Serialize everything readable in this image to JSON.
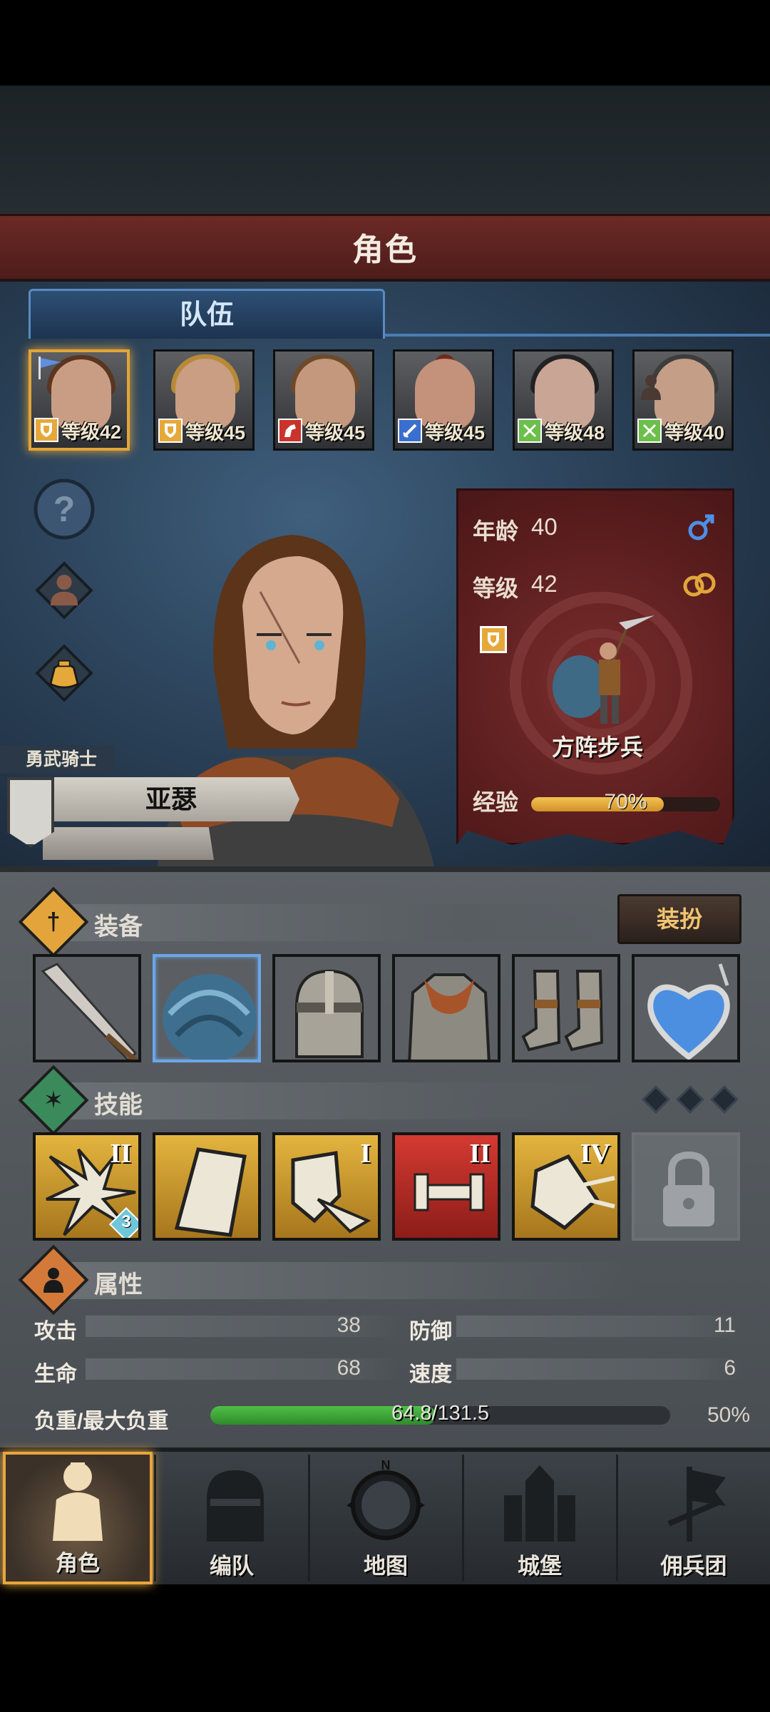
{
  "header": {
    "title": "角色"
  },
  "tabs": {
    "team": "队伍"
  },
  "heroes": [
    {
      "level": "等级42",
      "badge": "shield",
      "badge_color": "#e7a83a",
      "selected": true
    },
    {
      "level": "等级45",
      "badge": "shield",
      "badge_color": "#e7a83a"
    },
    {
      "level": "等级45",
      "badge": "horse",
      "badge_color": "#c8342c"
    },
    {
      "level": "等级45",
      "badge": "sword",
      "badge_color": "#3a6fd0"
    },
    {
      "level": "等级48",
      "badge": "bow",
      "badge_color": "#6bbf4a"
    },
    {
      "level": "等级40",
      "badge": "bow",
      "badge_color": "#6bbf4a"
    }
  ],
  "character": {
    "title": "勇武骑士",
    "name": "亚瑟",
    "age_label": "年龄",
    "age": "40",
    "level_label": "等级",
    "level": "42",
    "unit": "方阵步兵",
    "xp_label": "经验",
    "xp_percent": "70%",
    "xp_fraction": 0.7
  },
  "equipment": {
    "title": "装备",
    "dress_button": "装扮",
    "slots": [
      "spear-icon",
      "shield-plume-icon",
      "helmet-icon",
      "armor-icon",
      "boots-icon",
      "heart-amulet-icon"
    ]
  },
  "skills": {
    "title": "技能",
    "items": [
      {
        "icon": "burst-arrow-icon",
        "rank": "II",
        "sub": "3"
      },
      {
        "icon": "tower-shield-icon",
        "rank": ""
      },
      {
        "icon": "shield-arrow-icon",
        "rank": "I"
      },
      {
        "icon": "dumbbell-icon",
        "rank": "II"
      },
      {
        "icon": "shield-break-icon",
        "rank": "IV"
      },
      {
        "icon": "lock-icon",
        "rank": ""
      }
    ]
  },
  "attributes": {
    "title": "属性",
    "attack_label": "攻击",
    "attack": "38",
    "defense_label": "防御",
    "defense": "11",
    "hp_label": "生命",
    "hp": "68",
    "speed_label": "速度",
    "speed": "6",
    "load_label": "负重/最大负重",
    "load": "64.8/131.5",
    "load_percent": "50%",
    "load_fraction": 0.49
  },
  "nav": {
    "character": "角色",
    "formation": "编队",
    "map": "地图",
    "castle": "城堡",
    "mercenary": "佣兵团",
    "compass_n": "N"
  },
  "colors": {
    "accent": "#e8a63c",
    "header": "#6b2a26",
    "xp": "#e1a83b",
    "load": "#4fbf48"
  }
}
